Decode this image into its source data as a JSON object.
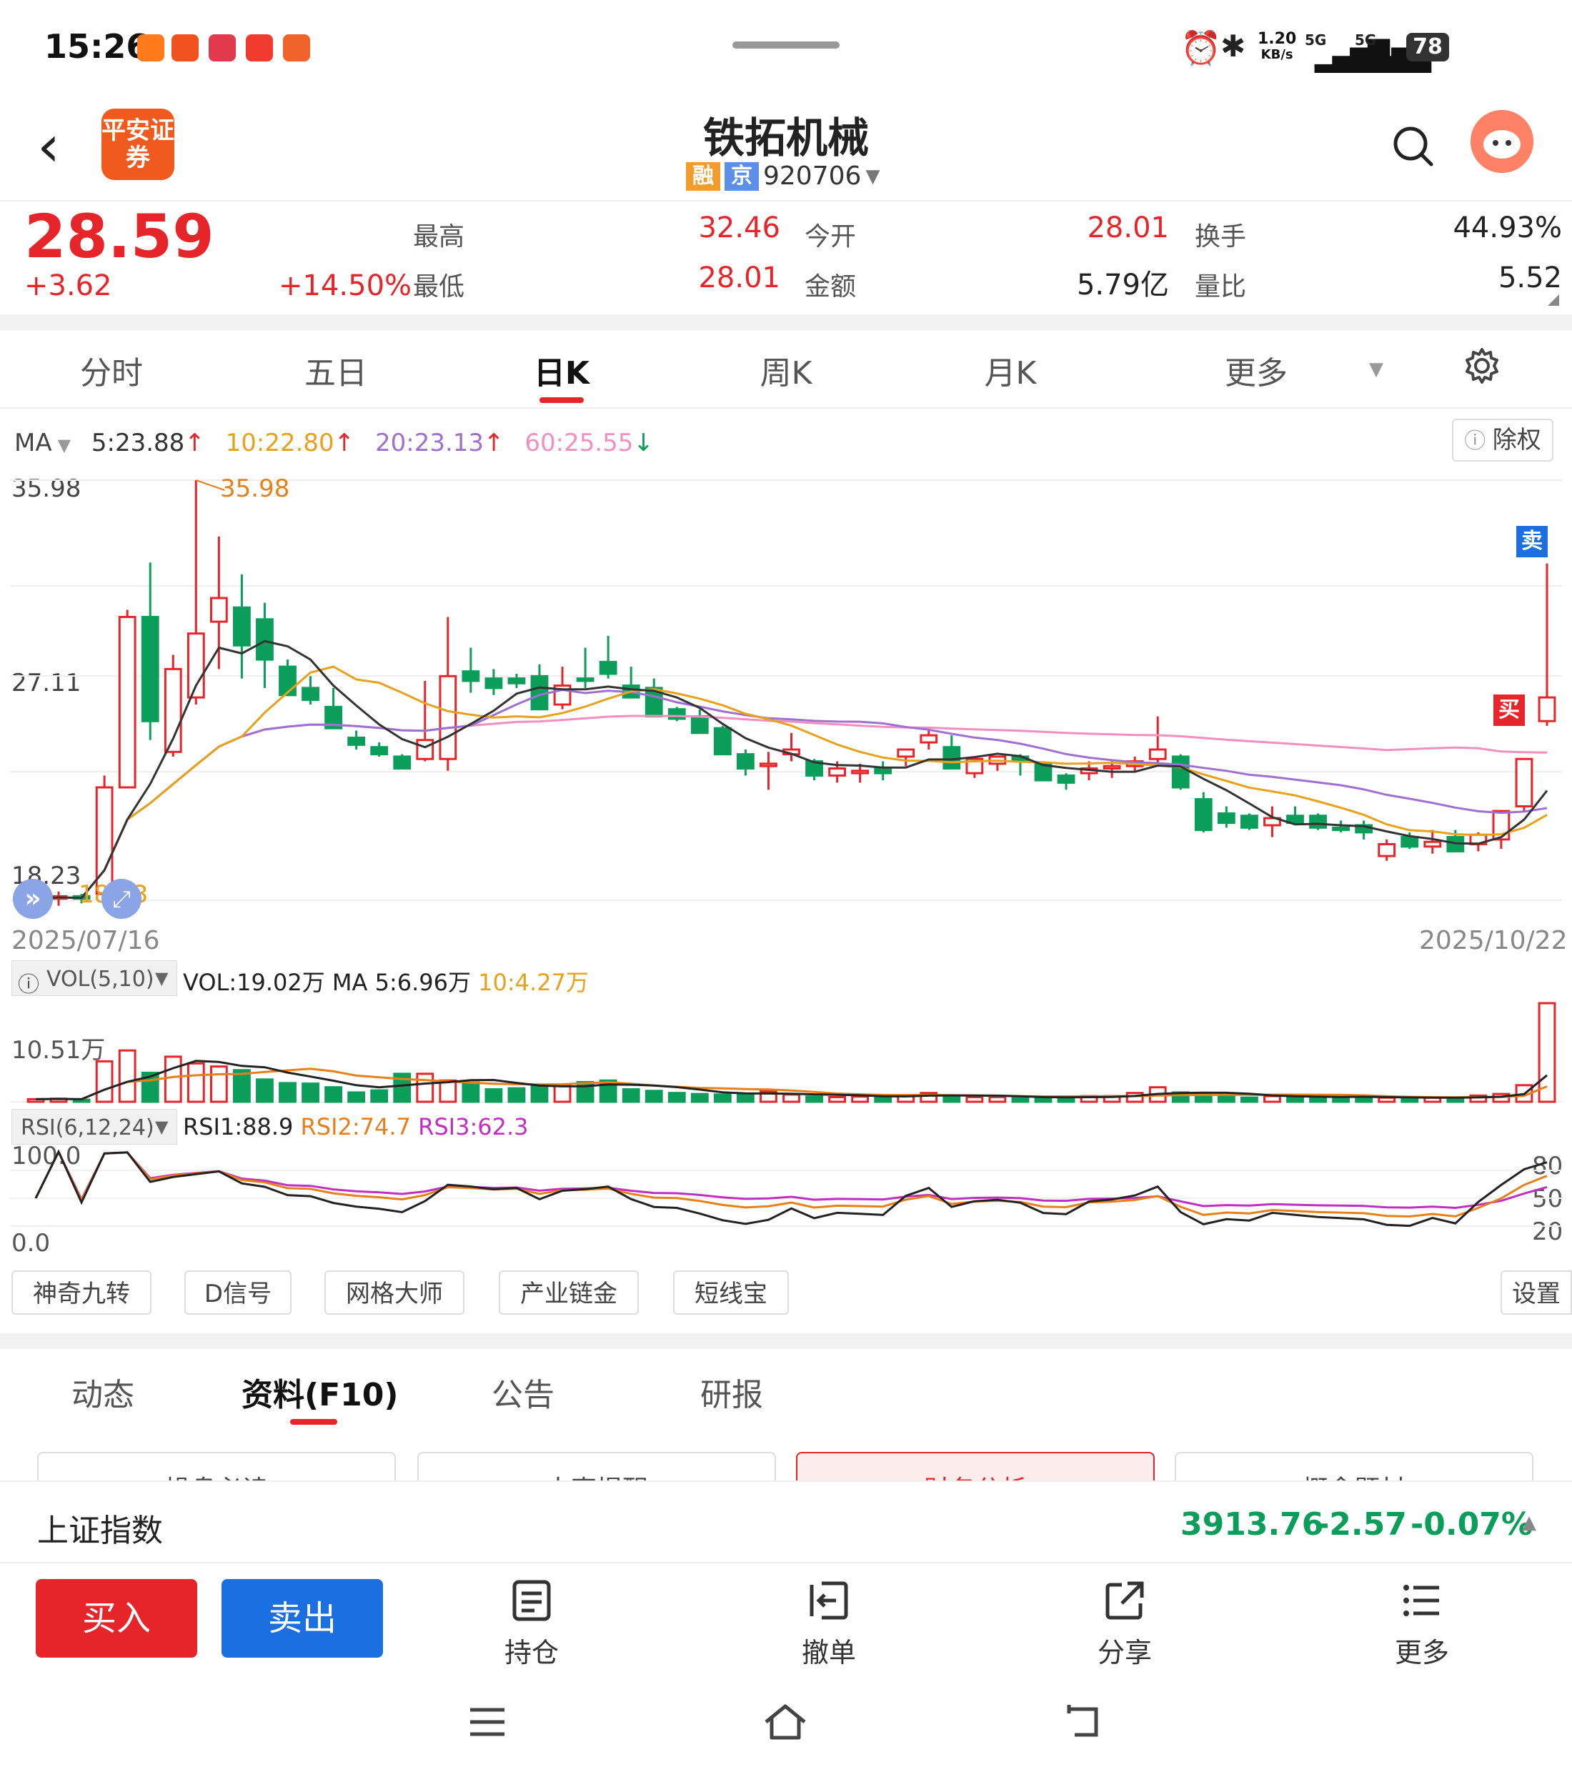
{
  "status_bar": {
    "time": "15:26",
    "net_speed_value": "1.20",
    "net_speed_unit": "KB/s",
    "sim1": "5G",
    "sim2": "5G",
    "battery": "78"
  },
  "header": {
    "back_icon": "back-arrow-icon",
    "broker_logo_text": "平安证券",
    "stock_name": "铁拓机械",
    "tag_margin": "融",
    "tag_exchange": "京",
    "code": "920706"
  },
  "quote": {
    "price": "28.59",
    "change": "+3.62",
    "change_pct": "+14.50%",
    "fields": [
      {
        "label": "最高",
        "value": "32.46",
        "color": "#e6252a"
      },
      {
        "label": "今开",
        "value": "28.01",
        "color": "#e6252a"
      },
      {
        "label": "换手",
        "value": "44.93%",
        "color": "#222222"
      },
      {
        "label": "最低",
        "value": "28.01",
        "color": "#e6252a"
      },
      {
        "label": "金额",
        "value": "5.79亿",
        "color": "#222222"
      },
      {
        "label": "量比",
        "value": "5.52",
        "color": "#222222"
      }
    ]
  },
  "period_tabs": {
    "items": [
      "分时",
      "五日",
      "日K",
      "周K",
      "月K",
      "更多"
    ],
    "active": "日K"
  },
  "ma_legend": {
    "label": "MA",
    "ma5": "5:23.88",
    "ma10": "10:22.80",
    "ma20": "20:23.13",
    "ma60": "60:25.55",
    "ex_rights_button": "除权"
  },
  "kline": {
    "y_high": "35.98",
    "y_mid": "27.11",
    "y_low": "18.23",
    "max_marker": "35.98",
    "min_marker": "18.23",
    "date_start": "2025/07/16",
    "date_end": "2025/10/22",
    "sell_marker": "卖",
    "buy_marker": "买"
  },
  "volume": {
    "selector": "VOL(5,10)",
    "vol_text": "VOL:19.02万",
    "ma5_text": "MA 5:6.96万",
    "ma10_text": "10:4.27万",
    "y_label": "10.51万"
  },
  "rsi": {
    "selector": "RSI(6,12,24)",
    "rsi1": "RSI1:88.9",
    "rsi2": "RSI2:74.7",
    "rsi3": "RSI3:62.3",
    "y_top": "100.0",
    "y_bottom": "0.0",
    "right_labels": [
      "80",
      "50",
      "20"
    ]
  },
  "tools": [
    "神奇九转",
    "D信号",
    "网格大师",
    "产业链金",
    "短线宝"
  ],
  "tools_settings": "设置",
  "f10_tabs": {
    "items": [
      "动态",
      "资料(F10)",
      "公告",
      "研报"
    ],
    "active": "资料(F10)"
  },
  "f10_sub_buttons": [
    "操盘必读",
    "大事提醒",
    "财务分析",
    "概念题材"
  ],
  "index_bar": {
    "name": "上证指数",
    "value": "3913.76",
    "change": "-2.57",
    "change_pct": "-0.07%"
  },
  "bottom_actions": {
    "buy": "买入",
    "sell": "卖出",
    "items": [
      {
        "label": "持仓",
        "icon": "position-list-icon"
      },
      {
        "label": "撤单",
        "icon": "cancel-order-icon"
      },
      {
        "label": "分享",
        "icon": "share-icon"
      },
      {
        "label": "更多",
        "icon": "more-menu-icon"
      }
    ]
  },
  "colors": {
    "up": "#e6252a",
    "down": "#0a9e5a",
    "ma5": "#333333",
    "ma10": "#e8a21a",
    "ma20": "#a070d0",
    "ma60": "#f08fc0",
    "buy_button": "#e6252a",
    "sell_button": "#1c6fe0"
  },
  "chart_data": {
    "type": "candlestick",
    "x_start": "2025/07/16",
    "x_end": "2025/10/22",
    "y_range": [
      18.23,
      35.98
    ],
    "ohlc": [
      [
        18.1,
        18.5,
        18.0,
        18.3
      ],
      [
        18.3,
        18.6,
        18.0,
        18.4
      ],
      [
        18.4,
        18.5,
        18.1,
        18.3
      ],
      [
        18.5,
        23.5,
        18.4,
        23.0
      ],
      [
        23.0,
        30.5,
        27.0,
        30.2
      ],
      [
        30.2,
        32.5,
        25.0,
        25.8
      ],
      [
        24.5,
        28.6,
        24.3,
        28.0
      ],
      [
        26.8,
        35.98,
        26.5,
        29.5
      ],
      [
        30.0,
        33.6,
        28.0,
        31.0
      ],
      [
        30.6,
        32.0,
        27.6,
        29.0
      ],
      [
        30.1,
        30.8,
        27.2,
        28.4
      ],
      [
        28.1,
        28.4,
        26.9,
        26.9
      ],
      [
        27.2,
        27.7,
        26.5,
        26.7
      ],
      [
        26.4,
        27.2,
        25.7,
        25.5
      ],
      [
        25.1,
        25.4,
        24.6,
        24.8
      ],
      [
        24.7,
        24.9,
        24.3,
        24.4
      ],
      [
        24.3,
        24.4,
        23.9,
        23.8
      ],
      [
        24.2,
        27.5,
        24.1,
        25.0
      ],
      [
        24.2,
        30.2,
        23.7,
        27.7
      ],
      [
        27.9,
        28.9,
        27.0,
        27.5
      ],
      [
        27.6,
        28.0,
        26.9,
        27.2
      ],
      [
        27.6,
        27.8,
        27.2,
        27.4
      ],
      [
        27.7,
        28.2,
        26.8,
        26.3
      ],
      [
        26.5,
        28.1,
        26.3,
        27.3
      ],
      [
        27.6,
        28.9,
        27.2,
        27.5
      ],
      [
        28.3,
        29.4,
        27.6,
        27.8
      ],
      [
        27.3,
        28.1,
        26.9,
        26.8
      ],
      [
        27.2,
        27.6,
        26.0,
        26.0
      ],
      [
        26.3,
        26.4,
        25.8,
        25.9
      ],
      [
        26.0,
        26.3,
        25.3,
        25.3
      ],
      [
        25.5,
        25.6,
        24.5,
        24.4
      ],
      [
        24.4,
        24.6,
        23.5,
        23.8
      ],
      [
        23.9,
        24.5,
        22.9,
        24.0
      ],
      [
        24.4,
        25.3,
        24.1,
        24.6
      ],
      [
        24.1,
        24.2,
        23.3,
        23.5
      ],
      [
        23.5,
        24.1,
        23.2,
        23.8
      ],
      [
        23.6,
        24.0,
        23.2,
        23.7
      ],
      [
        23.8,
        24.1,
        23.3,
        23.6
      ],
      [
        24.3,
        24.6,
        23.9,
        24.6
      ],
      [
        24.9,
        25.4,
        24.6,
        25.2
      ],
      [
        24.7,
        25.2,
        23.9,
        23.8
      ],
      [
        23.6,
        24.3,
        23.4,
        24.2
      ],
      [
        24.0,
        24.3,
        23.7,
        24.3
      ],
      [
        24.3,
        24.4,
        23.5,
        24.1
      ],
      [
        24.0,
        24.1,
        23.4,
        23.3
      ],
      [
        23.5,
        23.6,
        22.9,
        23.2
      ],
      [
        23.6,
        24.1,
        23.3,
        23.8
      ],
      [
        23.8,
        24.1,
        23.4,
        23.9
      ],
      [
        23.9,
        24.3,
        23.7,
        24.1
      ],
      [
        24.2,
        26.0,
        24.0,
        24.6
      ],
      [
        24.3,
        24.4,
        22.9,
        23.0
      ],
      [
        22.5,
        22.8,
        21.1,
        21.2
      ],
      [
        21.9,
        22.2,
        21.3,
        21.5
      ],
      [
        21.8,
        21.9,
        21.2,
        21.3
      ],
      [
        21.4,
        22.2,
        20.9,
        21.7
      ],
      [
        21.8,
        22.2,
        21.5,
        21.5
      ],
      [
        21.8,
        21.9,
        21.2,
        21.3
      ],
      [
        21.3,
        21.6,
        21.1,
        21.2
      ],
      [
        21.4,
        21.6,
        20.8,
        21.1
      ],
      [
        20.1,
        20.8,
        19.9,
        20.6
      ],
      [
        20.9,
        21.1,
        20.4,
        20.5
      ],
      [
        20.5,
        21.2,
        20.2,
        20.7
      ],
      [
        20.9,
        21.2,
        20.3,
        20.3
      ],
      [
        20.6,
        21.1,
        20.3,
        21.0
      ],
      [
        20.8,
        22.0,
        20.4,
        22.0
      ],
      [
        22.2,
        23.9,
        22.0,
        24.2
      ],
      [
        25.8,
        32.46,
        25.6,
        26.8
      ]
    ],
    "volume_wan": [
      0.5,
      0.6,
      0.4,
      7.8,
      9.9,
      5.6,
      8.7,
      7.4,
      6.8,
      6.1,
      4.3,
      3.6,
      3.5,
      2.8,
      1.8,
      2.2,
      5.4,
      5.4,
      4.1,
      3.7,
      2.4,
      2.6,
      2.9,
      3.3,
      3.8,
      4.1,
      2.4,
      2.1,
      1.7,
      1.5,
      1.4,
      1.4,
      2.0,
      1.4,
      1.0,
      0.9,
      1.0,
      1.0,
      1.3,
      1.7,
      1.1,
      0.9,
      0.9,
      0.8,
      0.8,
      0.9,
      1.1,
      1.1,
      1.7,
      2.8,
      1.8,
      1.4,
      1.0,
      0.8,
      1.1,
      1.0,
      1.0,
      0.8,
      0.9,
      0.8,
      0.7,
      0.8,
      0.7,
      1.2,
      1.5,
      3.2,
      19.02
    ],
    "rsi_series": {
      "rsi1_end": 88.9,
      "rsi2_end": 74.7,
      "rsi3_end": 62.3
    }
  }
}
